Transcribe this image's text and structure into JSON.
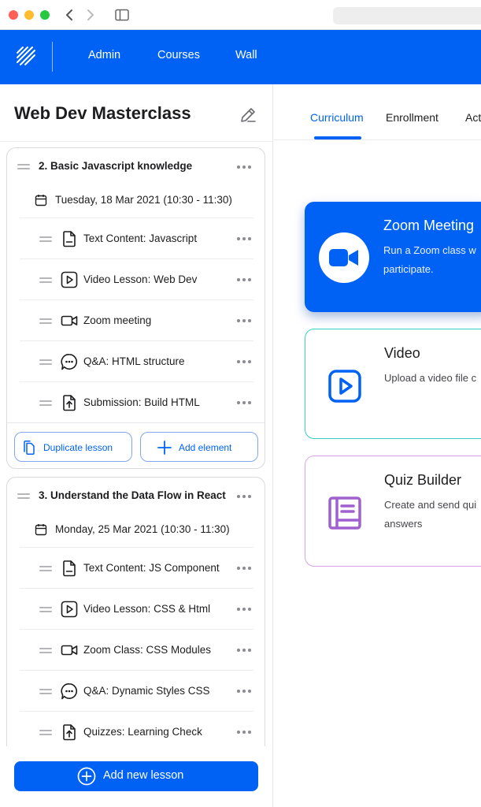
{
  "topnav": {
    "items": [
      "Admin",
      "Courses",
      "Wall"
    ]
  },
  "course": {
    "title": "Web Dev Masterclass"
  },
  "lessons": [
    {
      "title": "2. Basic Javascript knowledge",
      "date": "Tuesday, 18 Mar 2021 (10:30 - 11:30)",
      "elements": [
        {
          "icon": "document-icon",
          "label": "Text Content: Javascript"
        },
        {
          "icon": "play-icon",
          "label": "Video Lesson: Web Dev"
        },
        {
          "icon": "video-camera-icon",
          "label": "Zoom meeting"
        },
        {
          "icon": "chat-bubble-icon",
          "label": "Q&A: HTML structure"
        },
        {
          "icon": "upload-file-icon",
          "label": "Submission: Build HTML"
        }
      ],
      "actions": {
        "duplicate": "Duplicate lesson",
        "add": "Add element"
      }
    },
    {
      "title": "3. Understand the Data Flow in React",
      "date": "Monday, 25 Mar 2021 (10:30 - 11:30)",
      "elements": [
        {
          "icon": "document-icon",
          "label": "Text Content: JS Component"
        },
        {
          "icon": "play-icon",
          "label": "Video Lesson: CSS & Html"
        },
        {
          "icon": "video-camera-icon",
          "label": "Zoom Class: CSS Modules"
        },
        {
          "icon": "chat-bubble-icon",
          "label": "Q&A: Dynamic Styles CSS"
        },
        {
          "icon": "upload-file-icon",
          "label": "Quizzes: Learning Check"
        }
      ]
    }
  ],
  "add_lesson_label": "Add new lesson",
  "tabs": [
    {
      "label": "Curriculum",
      "active": true
    },
    {
      "label": "Enrollment",
      "active": false
    },
    {
      "label": "Act",
      "active": false
    }
  ],
  "element_types": [
    {
      "icon": "zoom-camera-icon",
      "title": "Zoom Meeting",
      "desc_line1": "Run a Zoom class w",
      "desc_line2": "participate."
    },
    {
      "icon": "video-play-icon",
      "title": "Video",
      "desc_line1": "Upload a video file c",
      "desc_line2": ""
    },
    {
      "icon": "quiz-book-icon",
      "title": "Quiz Builder",
      "desc_line1": "Create and send qui",
      "desc_line2": "answers"
    }
  ],
  "colors": {
    "brand_blue": "#0062f5",
    "video_teal": "#37cfc4",
    "quiz_purple": "#a060d0"
  }
}
